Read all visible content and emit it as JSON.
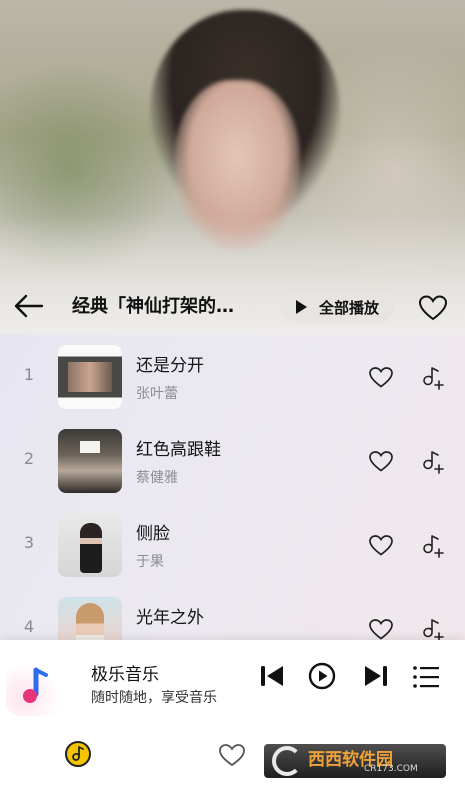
{
  "header": {
    "title": "经典「神仙打架的…",
    "play_all_label": "全部播放"
  },
  "songs": [
    {
      "index": "1",
      "name": "还是分开",
      "artist": "张叶蕾"
    },
    {
      "index": "2",
      "name": "红色高跟鞋",
      "artist": "蔡健雅"
    },
    {
      "index": "3",
      "name": "侧脸",
      "artist": "于果"
    },
    {
      "index": "4",
      "name": "光年之外",
      "artist": ""
    }
  ],
  "player": {
    "title": "极乐音乐",
    "subtitle": "随时随地，享受音乐"
  },
  "watermark": {
    "text": "西西软件园",
    "url": "CR173.COM"
  },
  "colors": {
    "accent_yellow": "#f5c400",
    "icon_dark": "#111111",
    "list_bg": "#ece9f0"
  }
}
